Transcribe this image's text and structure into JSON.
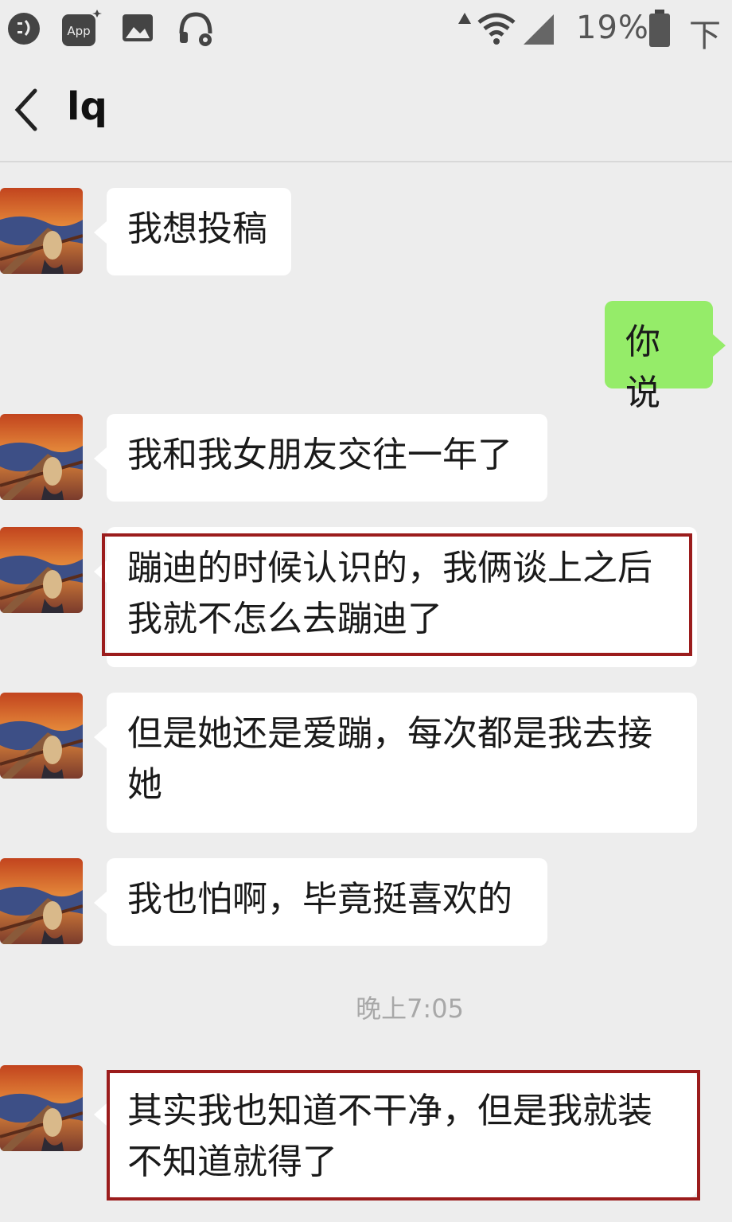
{
  "status_bar": {
    "app_label": "App",
    "battery": "19%",
    "time": "下午"
  },
  "header": {
    "title": "lq"
  },
  "messages": [
    {
      "side": "in",
      "text": "我想投稿"
    },
    {
      "side": "out",
      "text": "你说"
    },
    {
      "side": "in",
      "text": "我和我女朋友交往一年了"
    },
    {
      "side": "in",
      "text": "蹦迪的时候认识的，我俩谈上之后我就不怎么去蹦迪了",
      "highlighted": true
    },
    {
      "side": "in",
      "text": "但是她还是爱蹦，每次都是我去接她"
    },
    {
      "side": "in",
      "text": "我也怕啊，毕竟挺喜欢的"
    },
    {
      "side": "in",
      "text": "其实我也知道不干净，但是我就装不知道就得了",
      "highlighted": true
    }
  ],
  "timestamp": "晚上7:05",
  "colors": {
    "background": "#ededed",
    "incoming_bubble": "#ffffff",
    "outgoing_bubble": "#95ec69",
    "highlight_border": "#9b1c1c"
  }
}
